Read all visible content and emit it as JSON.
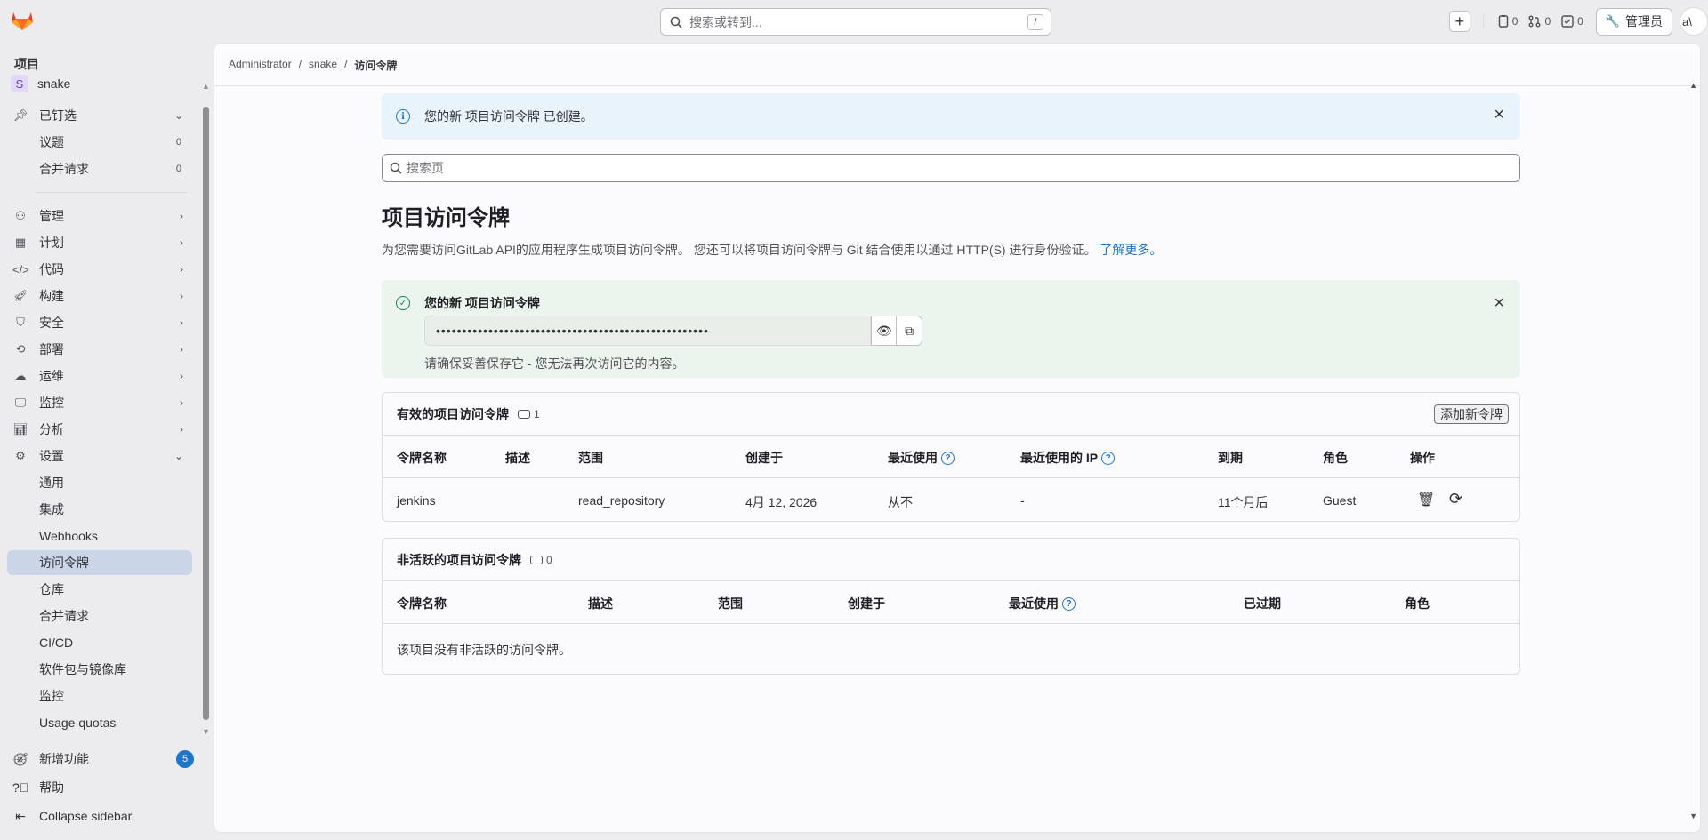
{
  "topbar": {
    "search_placeholder": "搜索或转到...",
    "search_shortcut": "/",
    "issues_count": "0",
    "mr_count": "0",
    "todo_count": "0",
    "admin_label": "管理员",
    "avatar_alt": "a\\"
  },
  "sidebar": {
    "header": "项目",
    "project": {
      "initial": "S",
      "name": "snake"
    },
    "pinned": {
      "label": "已钉选",
      "items": [
        {
          "label": "议题",
          "count": "0"
        },
        {
          "label": "合并请求",
          "count": "0"
        }
      ]
    },
    "sections": [
      {
        "label": "管理",
        "icon": "manage-icon"
      },
      {
        "label": "计划",
        "icon": "plan-icon"
      },
      {
        "label": "代码",
        "icon": "code-icon"
      },
      {
        "label": "构建",
        "icon": "rocket-icon"
      },
      {
        "label": "安全",
        "icon": "shield-icon"
      },
      {
        "label": "部署",
        "icon": "deploy-icon"
      },
      {
        "label": "运维",
        "icon": "cloud-icon"
      },
      {
        "label": "监控",
        "icon": "monitor-icon"
      },
      {
        "label": "分析",
        "icon": "chart-icon"
      },
      {
        "label": "设置",
        "icon": "settings-icon"
      }
    ],
    "settings_items": [
      {
        "label": "通用"
      },
      {
        "label": "集成"
      },
      {
        "label": "Webhooks"
      },
      {
        "label": "访问令牌"
      },
      {
        "label": "仓库"
      },
      {
        "label": "合并请求"
      },
      {
        "label": "CI/CD"
      },
      {
        "label": "软件包与镜像库"
      },
      {
        "label": "监控"
      },
      {
        "label": "Usage quotas"
      }
    ],
    "whats_new": {
      "label": "新增功能",
      "badge": "5"
    },
    "help": "帮助",
    "collapse": "Collapse sidebar"
  },
  "breadcrumb": [
    "Administrator",
    "snake",
    "访问令牌"
  ],
  "breadcrumb_sep": "/",
  "info_alert": "您的新 项目访问令牌 已创建。",
  "page_search_placeholder": "搜索页",
  "page_title": "项目访问令牌",
  "page_description": "为您需要访问GitLab API的应用程序生成项目访问令牌。 您还可以将项目访问令牌与 Git 结合使用以通过 HTTP(S) 进行身份验证。",
  "learn_more": "了解更多。",
  "success_alert": {
    "title": "您的新 项目访问令牌",
    "token_masked": "••••••••••••••••••••••••••••••••••••••••••••••••••••",
    "warning": "请确保妥善保存它 - 您无法再次访问它的内容。"
  },
  "active_tokens": {
    "title": "有效的项目访问令牌",
    "count": "1",
    "add_button": "添加新令牌",
    "columns": [
      "令牌名称",
      "描述",
      "范围",
      "创建于",
      "最近使用",
      "最近使用的 IP",
      "到期",
      "角色",
      "操作"
    ],
    "rows": [
      {
        "name": "jenkins",
        "description": "",
        "scope": "read_repository",
        "created": "4月 12, 2026",
        "last_used": "从不",
        "last_ip": "-",
        "expires": "11个月后",
        "role": "Guest"
      }
    ]
  },
  "inactive_tokens": {
    "title": "非活跃的项目访问令牌",
    "count": "0",
    "columns": [
      "令牌名称",
      "描述",
      "范围",
      "创建于",
      "最近使用",
      "已过期",
      "角色"
    ],
    "empty_text": "该项目没有非活跃的访问令牌。"
  },
  "colors": {
    "accent": "#1f75cb",
    "success": "#108548",
    "info_bg": "#e9f3fc",
    "success_bg": "#ecf4ee",
    "active_nav": "#cbd5e8"
  }
}
